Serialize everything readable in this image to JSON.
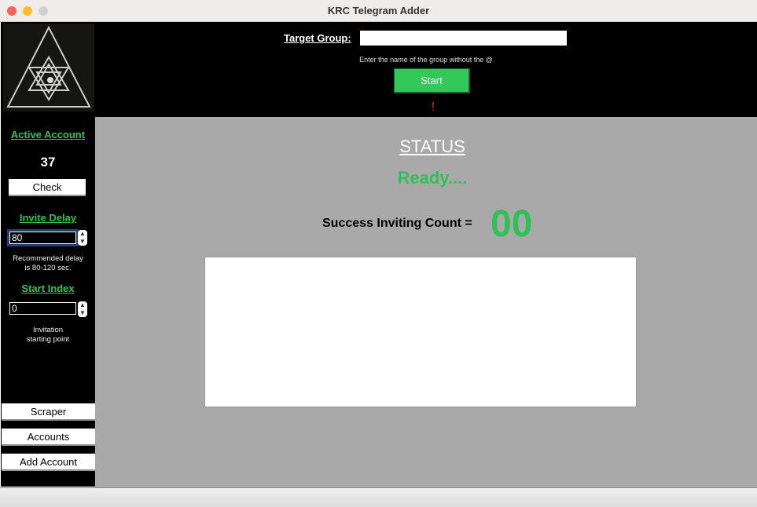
{
  "window": {
    "title": "KRC Telegram Adder"
  },
  "sidebar": {
    "active_account_label": "Active Account",
    "active_account_value": "37",
    "check_label": "Check",
    "invite_delay_label": "Invite Delay",
    "invite_delay_value": "80",
    "invite_delay_hint_1": "Recommended delay",
    "invite_delay_hint_2": "is 80-120 sec.",
    "start_index_label": "Start Index",
    "start_index_value": "0",
    "start_index_hint_1": "Invitation",
    "start_index_hint_2": "starting point",
    "nav": [
      {
        "label": "Scraper"
      },
      {
        "label": "Accounts"
      },
      {
        "label": "Add Account"
      }
    ]
  },
  "top": {
    "target_group_label": "Target Group:",
    "target_group_value": "",
    "hint": "Enter the name of the group without the @",
    "start_label": "Start",
    "alert": "!"
  },
  "main": {
    "status_heading": "STATUS",
    "status_text": "Ready....",
    "count_label": "Success Inviting Count =",
    "count_value": "00",
    "log": ""
  },
  "colors": {
    "accent": "#2ec256",
    "alert": "#e0261a"
  }
}
